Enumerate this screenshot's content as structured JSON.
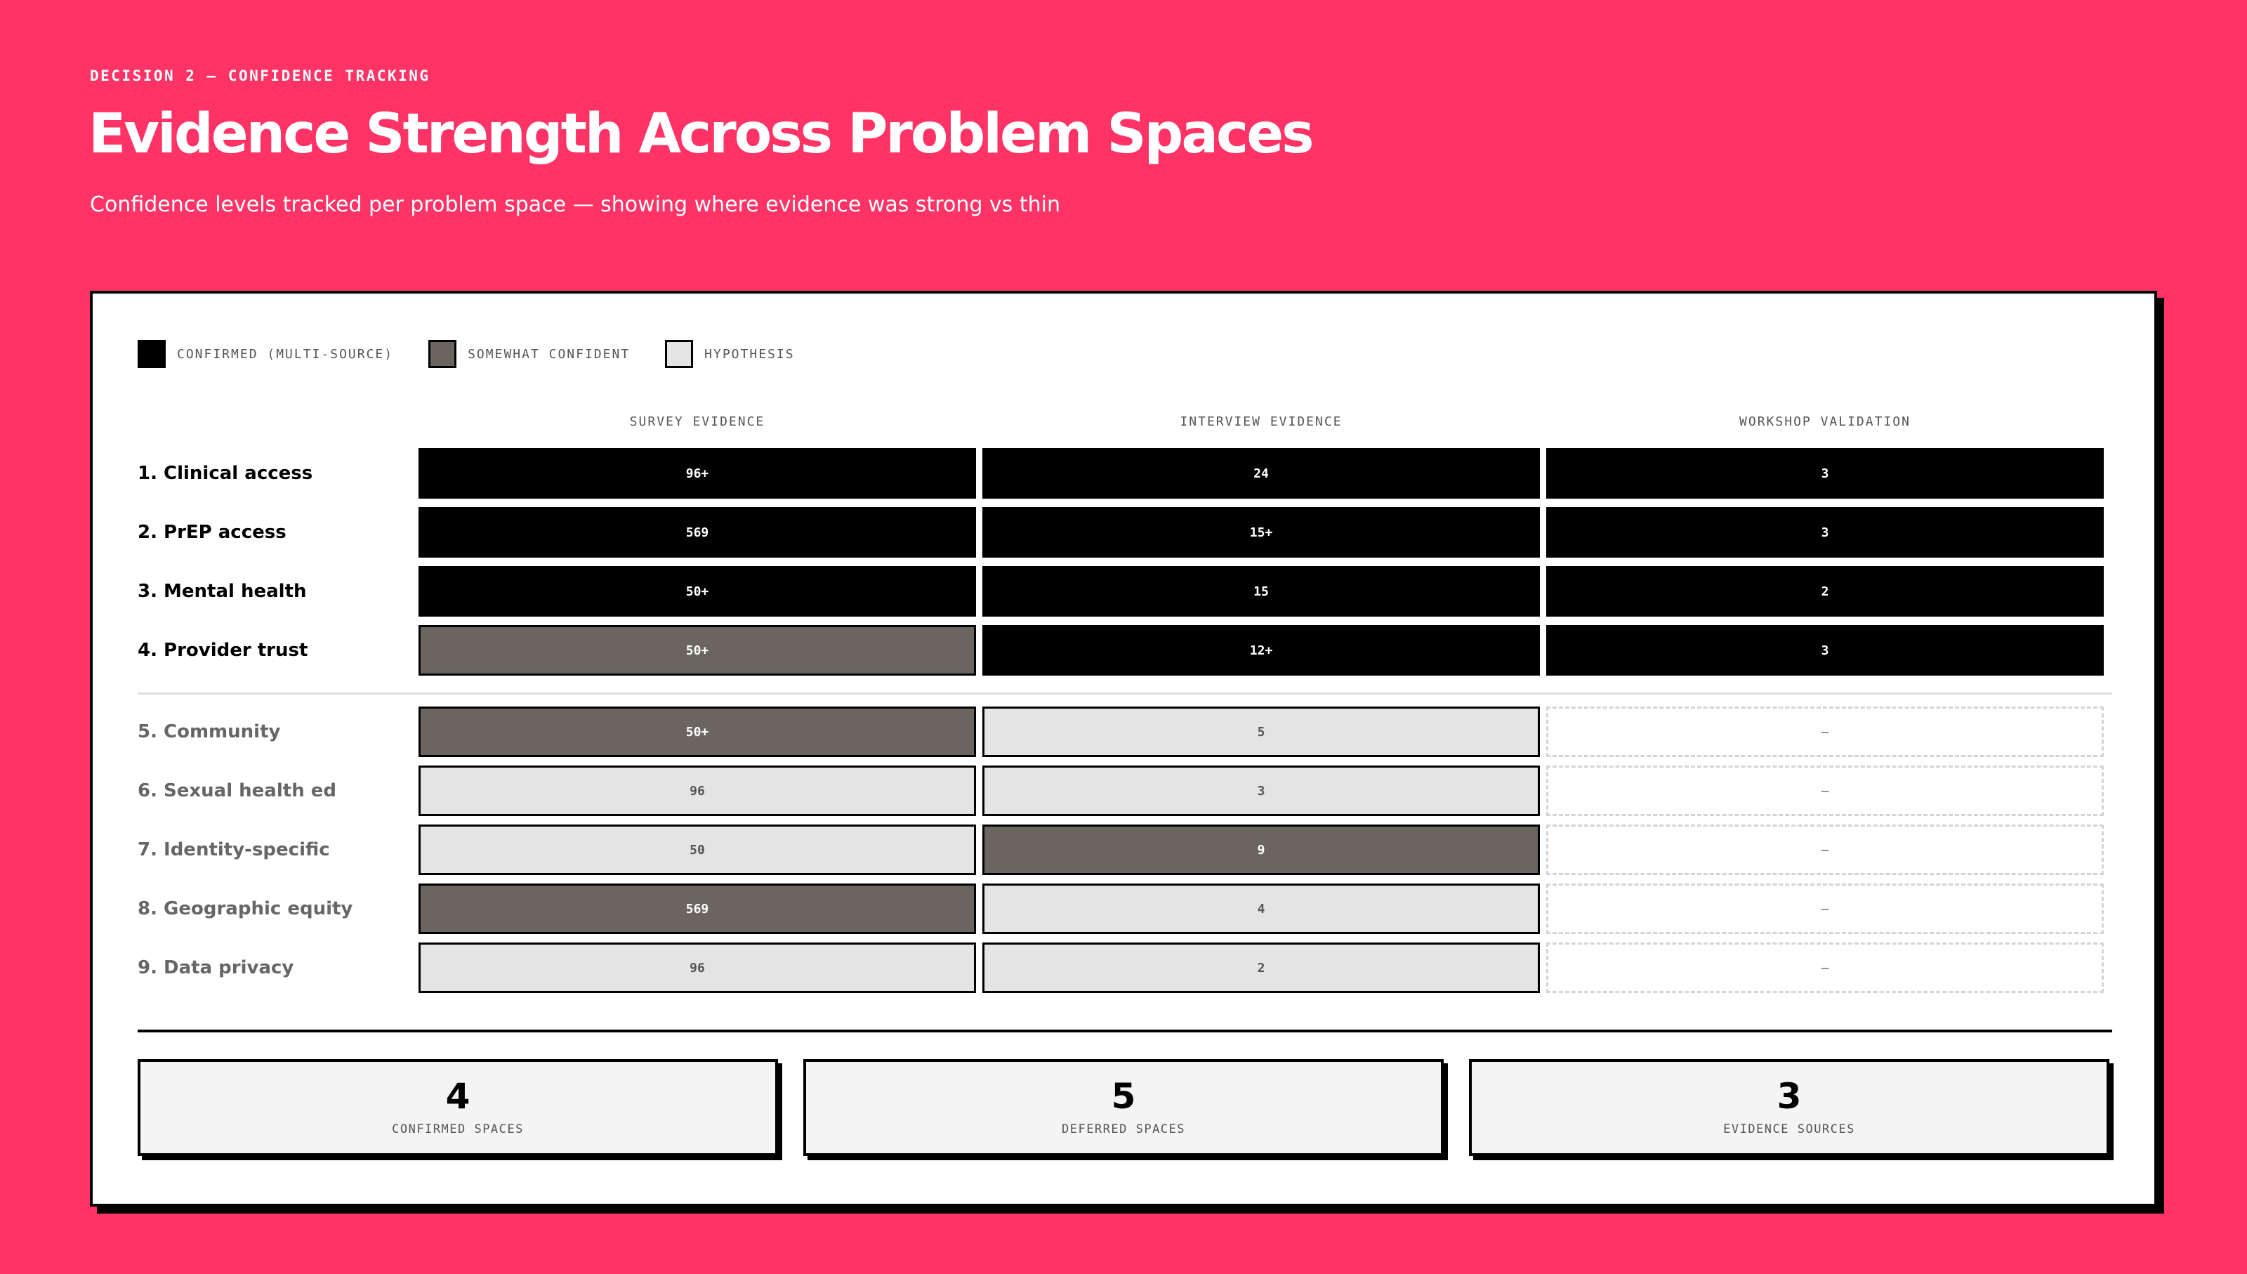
{
  "header": {
    "eyebrow": "DECISION 2 — CONFIDENCE TRACKING",
    "title": "Evidence Strength Across Problem Spaces",
    "subtitle": "Confidence levels tracked per problem space — showing where evidence was strong vs thin"
  },
  "legend": [
    {
      "label": "CONFIRMED (MULTI-SOURCE)",
      "color": "#000000"
    },
    {
      "label": "SOMEWHAT CONFIDENT",
      "color": "#6b655f"
    },
    {
      "label": "HYPOTHESIS",
      "color": "#e4e4e4"
    }
  ],
  "columns": [
    "SURVEY EVIDENCE",
    "INTERVIEW EVIDENCE",
    "WORKSHOP VALIDATION"
  ],
  "colors": {
    "background": "#ff3366",
    "confirmed": "#000000",
    "somewhat": "#6b655f",
    "hypothesis": "#e4e4e4",
    "primary_label": "#000000",
    "secondary_label": "#666666"
  },
  "rows": [
    {
      "label": "1. Clinical access",
      "group": "primary",
      "cells": [
        {
          "value": "96+",
          "level": "confirmed"
        },
        {
          "value": "24",
          "level": "confirmed"
        },
        {
          "value": "3",
          "level": "confirmed"
        }
      ]
    },
    {
      "label": "2. PrEP access",
      "group": "primary",
      "cells": [
        {
          "value": "569",
          "level": "confirmed"
        },
        {
          "value": "15+",
          "level": "confirmed"
        },
        {
          "value": "3",
          "level": "confirmed"
        }
      ]
    },
    {
      "label": "3. Mental health",
      "group": "primary",
      "cells": [
        {
          "value": "50+",
          "level": "confirmed"
        },
        {
          "value": "15",
          "level": "confirmed"
        },
        {
          "value": "2",
          "level": "confirmed"
        }
      ]
    },
    {
      "label": "4. Provider trust",
      "group": "primary",
      "cells": [
        {
          "value": "50+",
          "level": "somewhat"
        },
        {
          "value": "12+",
          "level": "confirmed"
        },
        {
          "value": "3",
          "level": "confirmed"
        }
      ]
    },
    {
      "label": "5. Community",
      "group": "deferred",
      "cells": [
        {
          "value": "50+",
          "level": "somewhat"
        },
        {
          "value": "5",
          "level": "hypothesis"
        },
        {
          "value": "–",
          "level": "none"
        }
      ]
    },
    {
      "label": "6. Sexual health ed",
      "group": "deferred",
      "cells": [
        {
          "value": "96",
          "level": "hypothesis"
        },
        {
          "value": "3",
          "level": "hypothesis"
        },
        {
          "value": "–",
          "level": "none"
        }
      ]
    },
    {
      "label": "7. Identity-specific",
      "group": "deferred",
      "cells": [
        {
          "value": "50",
          "level": "hypothesis"
        },
        {
          "value": "9",
          "level": "somewhat"
        },
        {
          "value": "–",
          "level": "none"
        }
      ]
    },
    {
      "label": "8. Geographic equity",
      "group": "deferred",
      "cells": [
        {
          "value": "569",
          "level": "somewhat"
        },
        {
          "value": "4",
          "level": "hypothesis"
        },
        {
          "value": "–",
          "level": "none"
        }
      ]
    },
    {
      "label": "9. Data privacy",
      "group": "deferred",
      "cells": [
        {
          "value": "96",
          "level": "hypothesis"
        },
        {
          "value": "2",
          "level": "hypothesis"
        },
        {
          "value": "–",
          "level": "none"
        }
      ]
    }
  ],
  "stats": [
    {
      "value": "4",
      "label": "CONFIRMED SPACES"
    },
    {
      "value": "5",
      "label": "DEFERRED SPACES"
    },
    {
      "value": "3",
      "label": "EVIDENCE SOURCES"
    }
  ]
}
